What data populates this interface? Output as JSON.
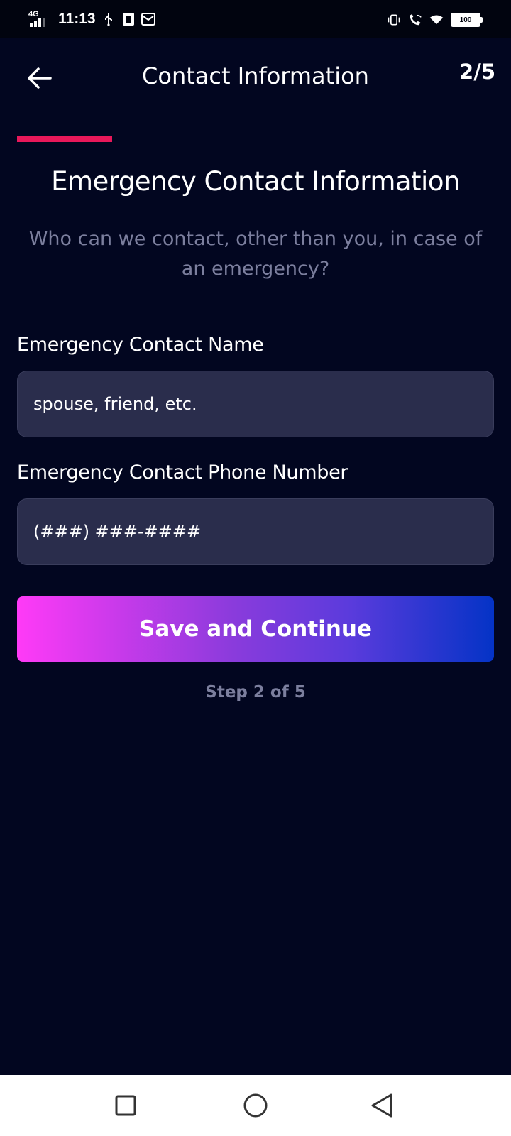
{
  "status_bar": {
    "network": "4G",
    "time": "11:13",
    "battery": "100"
  },
  "header": {
    "title": "Contact Information",
    "step_counter": "2/5"
  },
  "progress": {
    "fraction": 0.2,
    "color": "#e8185a"
  },
  "section": {
    "title": "Emergency Contact Information",
    "subtitle_line1": "Who can we contact, other than you, in case of",
    "subtitle_line2": "an emergency?"
  },
  "form": {
    "name_label": "Emergency Contact Name",
    "name_placeholder": "spouse, friend, etc.",
    "phone_label": "Emergency Contact Phone Number",
    "phone_placeholder": "(###) ###-####"
  },
  "actions": {
    "save_label": "Save and Continue"
  },
  "footer": {
    "step_text": "Step 2 of 5"
  },
  "icons": {
    "back": "arrow-left-icon",
    "usb": "usb-icon",
    "sim": "sim-card-icon",
    "mail": "mail-icon",
    "vibrate": "vibrate-icon",
    "wifi_call": "wifi-calling-icon",
    "wifi": "wifi-icon",
    "battery": "battery-icon",
    "recents": "square-recents-icon",
    "home": "circle-home-icon",
    "nav_back": "triangle-back-icon"
  },
  "colors": {
    "background": "#020620",
    "input_bg": "#2a2d4c",
    "muted_text": "#7c7f9e",
    "gradient_start": "#ff3af7",
    "gradient_end": "#0433c6"
  }
}
